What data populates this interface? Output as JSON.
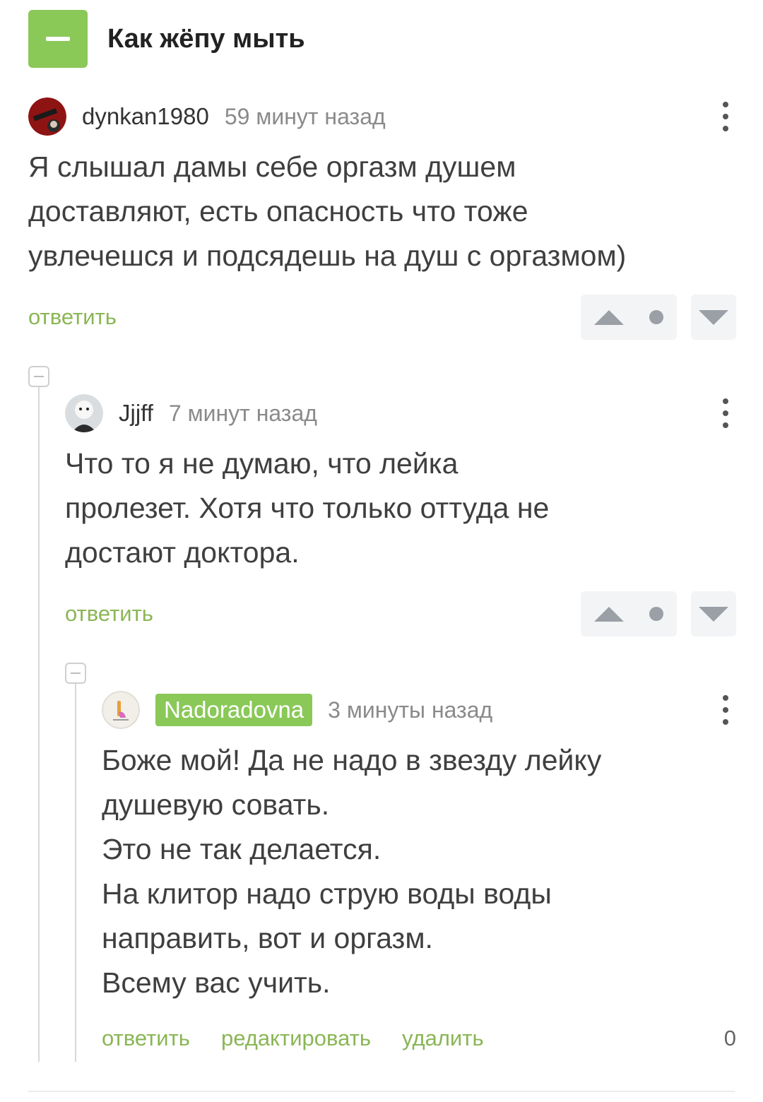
{
  "post": {
    "title": "Как жёпу мыть"
  },
  "comments": [
    {
      "username": "dynkan1980",
      "time": "59 минут назад",
      "text_lines": [
        "Я слышал дамы себе оргазм душем",
        "доставляют, есть опасность что тоже",
        "увлечешся и подсядешь на душ с оргазмом)"
      ],
      "reply_label": "ответить"
    },
    {
      "username": "Jjjff",
      "time": "7 минут назад",
      "text_lines": [
        "Что то я не думаю, что лейка",
        "пролезет. Хотя что только оттуда не",
        "достают доктора."
      ],
      "reply_label": "ответить"
    },
    {
      "username": "Nadoradovna",
      "time": "3 минуты назад",
      "text_lines": [
        "Боже мой! Да не надо в звезду лейку",
        "душевую совать.",
        "Это не так делается.",
        "На клитор надо струю воды воды",
        "направить, вот и оргазм.",
        "Всему вас учить."
      ],
      "reply_label": "ответить",
      "edit_label": "редактировать",
      "delete_label": "удалить",
      "score": "0"
    }
  ],
  "colors": {
    "accent": "#8ac858",
    "link": "#8ab655",
    "vote_bg": "#f3f4f5",
    "vote_icon": "#9aa0a6"
  }
}
